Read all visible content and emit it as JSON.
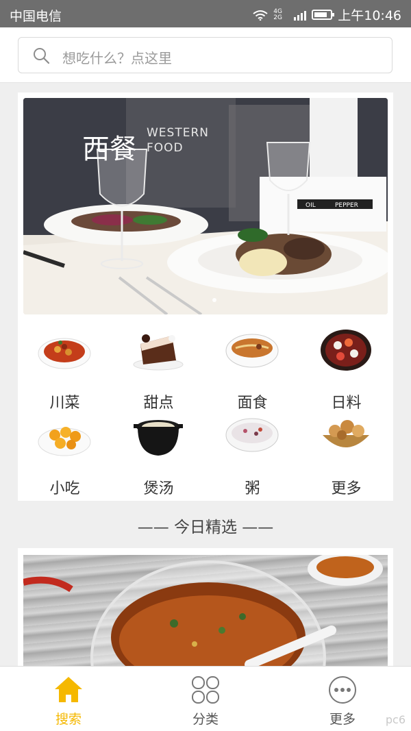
{
  "status_bar": {
    "carrier": "中国电信",
    "network": "4G 2G",
    "time": "上午10:46",
    "battery_level": 0.8
  },
  "search": {
    "placeholder": "想吃什么？点这里"
  },
  "banner": {
    "title_cn": "西餐",
    "title_en_line1": "WESTERN",
    "title_en_line2": "FOOD",
    "photo_labels": [
      "OIL",
      "PEPPER"
    ]
  },
  "categories": [
    {
      "label": "川菜"
    },
    {
      "label": "甜点"
    },
    {
      "label": "面食"
    },
    {
      "label": "日料"
    },
    {
      "label": "小吃"
    },
    {
      "label": "煲汤"
    },
    {
      "label": "粥"
    },
    {
      "label": "更多"
    }
  ],
  "section_title": "—— 今日精选 ——",
  "bottom_nav": {
    "items": [
      {
        "label": "搜索",
        "icon": "home-icon",
        "active": true
      },
      {
        "label": "分类",
        "icon": "category-grid-icon",
        "active": false
      },
      {
        "label": "更多",
        "icon": "more-dots-icon",
        "active": false
      }
    ]
  },
  "watermark": "pc6",
  "colors": {
    "accent": "#f5b800",
    "inactive": "#777777",
    "status_bar": "#6e6e6e"
  }
}
